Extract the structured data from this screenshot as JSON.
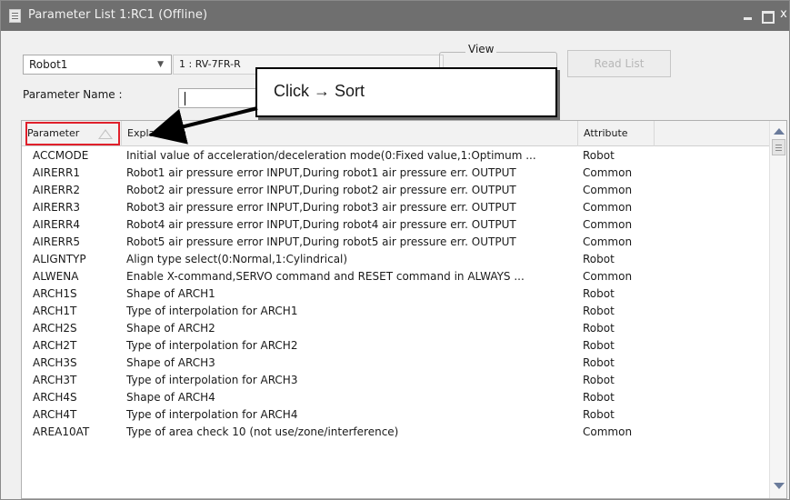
{
  "window": {
    "title": "Parameter List 1:RC1  (Offline)",
    "close_glyph": "x"
  },
  "toolbar": {
    "robot_value": "Robot1",
    "model_value": "1 : RV-7FR-R",
    "view_label": "View",
    "read_list_label": "Read List",
    "param_name_label": "Parameter Name :",
    "param_name_value": ""
  },
  "callout": {
    "text": "Click → Sort"
  },
  "table": {
    "headers": {
      "parameter": "Parameter",
      "explanation": "Explanation",
      "attribute": "Attribute"
    },
    "rows": [
      {
        "parameter": "ACCMODE",
        "explanation": "Initial value of acceleration/deceleration mode(0:Fixed value,1:Optimum ...",
        "attribute": "Robot"
      },
      {
        "parameter": "AIRERR1",
        "explanation": "Robot1 air pressure error INPUT,During robot1 air pressure err. OUTPUT",
        "attribute": "Common"
      },
      {
        "parameter": "AIRERR2",
        "explanation": "Robot2 air pressure error INPUT,During robot2 air pressure err. OUTPUT",
        "attribute": "Common"
      },
      {
        "parameter": "AIRERR3",
        "explanation": "Robot3 air pressure error INPUT,During robot3 air pressure err. OUTPUT",
        "attribute": "Common"
      },
      {
        "parameter": "AIRERR4",
        "explanation": "Robot4 air pressure error INPUT,During robot4 air pressure err. OUTPUT",
        "attribute": "Common"
      },
      {
        "parameter": "AIRERR5",
        "explanation": "Robot5 air pressure error INPUT,During robot5 air pressure err. OUTPUT",
        "attribute": "Common"
      },
      {
        "parameter": "ALIGNTYP",
        "explanation": "Align type select(0:Normal,1:Cylindrical)",
        "attribute": "Robot"
      },
      {
        "parameter": "ALWENA",
        "explanation": "Enable X-command,SERVO command and RESET command in ALWAYS ...",
        "attribute": "Common"
      },
      {
        "parameter": "ARCH1S",
        "explanation": "Shape of ARCH1",
        "attribute": "Robot"
      },
      {
        "parameter": "ARCH1T",
        "explanation": "Type of interpolation for ARCH1",
        "attribute": "Robot"
      },
      {
        "parameter": "ARCH2S",
        "explanation": "Shape of ARCH2",
        "attribute": "Robot"
      },
      {
        "parameter": "ARCH2T",
        "explanation": "Type of interpolation for ARCH2",
        "attribute": "Robot"
      },
      {
        "parameter": "ARCH3S",
        "explanation": "Shape of ARCH3",
        "attribute": "Robot"
      },
      {
        "parameter": "ARCH3T",
        "explanation": "Type of interpolation for ARCH3",
        "attribute": "Robot"
      },
      {
        "parameter": "ARCH4S",
        "explanation": "Shape of ARCH4",
        "attribute": "Robot"
      },
      {
        "parameter": "ARCH4T",
        "explanation": "Type of interpolation for ARCH4",
        "attribute": "Robot"
      },
      {
        "parameter": "AREA10AT",
        "explanation": "Type of area check 10 (not use/zone/interference)",
        "attribute": "Common"
      }
    ]
  },
  "colors": {
    "titlebar": "#6f6f6f",
    "highlight": "#e0202b",
    "disabled_text": "#b7b7b7"
  },
  "icons": [
    "window-icon",
    "minimize-icon",
    "maximize-icon",
    "close-icon",
    "chevron-down-icon",
    "sort-ascending-icon",
    "scroll-up-icon",
    "scroll-down-icon"
  ]
}
